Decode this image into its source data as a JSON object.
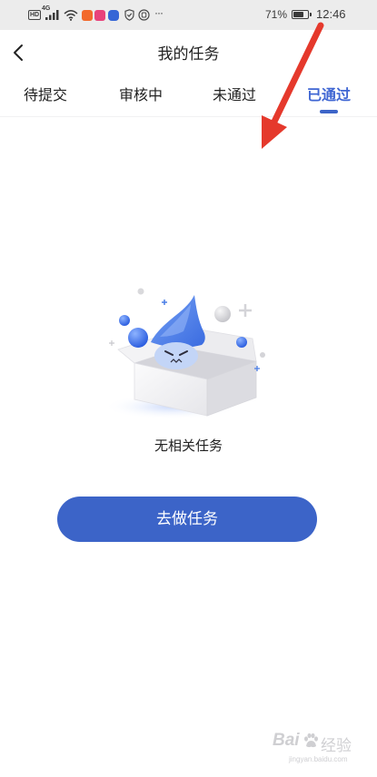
{
  "status_bar": {
    "hd_label": "HD",
    "network_label": "4G",
    "more_label": "···",
    "battery_percent": "71%",
    "battery_level": 0.71,
    "time": "12:46",
    "icons": [
      "hd-icon",
      "signal-icon",
      "wifi-icon",
      "shopping-app-icon",
      "video-app-icon",
      "browser-app-icon",
      "shield-icon",
      "security-app-icon",
      "more-icon",
      "battery-icon"
    ]
  },
  "header": {
    "back_icon": "chevron-left-icon",
    "title": "我的任务"
  },
  "tabs": {
    "items": [
      {
        "label": "待提交"
      },
      {
        "label": "审核中"
      },
      {
        "label": "未通过"
      },
      {
        "label": "已通过"
      }
    ],
    "selected_index": 3
  },
  "empty_state": {
    "illustration": "empty-box-mascot-illustration",
    "message": "无相关任务"
  },
  "primary_button": {
    "label": "去做任务"
  },
  "annotation": {
    "icon": "red-arrow-annotation",
    "color": "#e5392c"
  },
  "watermark": {
    "brand_prefix": "Bai",
    "brand_suffix": "经验",
    "url": "jingyan.baidu.com",
    "icon": "paw-logo-icon"
  },
  "colors": {
    "accent": "#3c64c8",
    "tab_selected": "#3f66d3",
    "text": "#222222",
    "status_bar_bg": "#ececec",
    "mascot_blue": "#4a7ee6"
  }
}
